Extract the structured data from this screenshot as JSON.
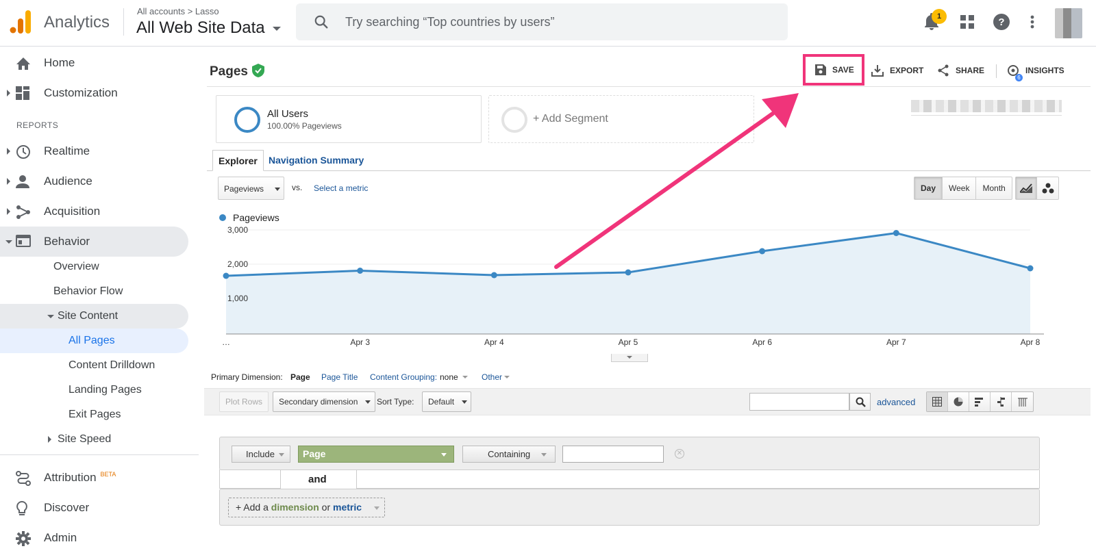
{
  "app": {
    "name": "Analytics"
  },
  "account": {
    "breadcrumb": "All accounts > Lasso",
    "view": "All Web Site Data"
  },
  "search": {
    "placeholder": "Try searching “Top countries by users”"
  },
  "notifications": {
    "count": "1"
  },
  "sidebar": {
    "items": [
      {
        "label": "Home",
        "icon": "home-icon"
      },
      {
        "label": "Customization",
        "icon": "dashboard-icon"
      }
    ],
    "reports_label": "REPORTS",
    "reports": [
      {
        "label": "Realtime",
        "icon": "clock-icon"
      },
      {
        "label": "Audience",
        "icon": "person-icon"
      },
      {
        "label": "Acquisition",
        "icon": "fork-icon"
      },
      {
        "label": "Behavior",
        "icon": "browser-window-icon"
      }
    ],
    "behavior_children": {
      "overview": "Overview",
      "behavior_flow": "Behavior Flow",
      "site_content": "Site Content",
      "all_pages": "All Pages",
      "content_drilldown": "Content Drilldown",
      "landing_pages": "Landing Pages",
      "exit_pages": "Exit Pages",
      "site_speed": "Site Speed"
    },
    "bottom": [
      {
        "label": "Attribution",
        "badge": "BETA",
        "icon": "attribution-icon"
      },
      {
        "label": "Discover",
        "icon": "lightbulb-icon"
      },
      {
        "label": "Admin",
        "icon": "gear-icon"
      }
    ]
  },
  "report": {
    "title": "Pages",
    "toolbar": {
      "save": "SAVE",
      "export": "EXPORT",
      "share": "SHARE",
      "insights": "INSIGHTS",
      "insights_count": "6"
    }
  },
  "segments": {
    "all_users": {
      "name": "All Users",
      "sub": "100.00% Pageviews"
    },
    "add": "+ Add Segment"
  },
  "tabs": {
    "explorer": "Explorer",
    "nav_summary": "Navigation Summary"
  },
  "controls": {
    "metric": "Pageviews",
    "vs": "vs.",
    "select_metric": "Select a metric",
    "day": "Day",
    "week": "Week",
    "month": "Month"
  },
  "chart_data": {
    "type": "area",
    "series": [
      {
        "name": "Pageviews",
        "values": [
          1700,
          1850,
          1720,
          1800,
          2420,
          2950,
          1920
        ]
      }
    ],
    "categories": [
      "…",
      "Apr 3",
      "Apr 4",
      "Apr 5",
      "Apr 6",
      "Apr 7",
      "Apr 8"
    ],
    "yticks": [
      "3,000",
      "2,000",
      "1,000"
    ],
    "ylim": [
      0,
      3000
    ],
    "grid": true,
    "colors": {
      "line": "#3b88c4",
      "fill": "#e7f1f8"
    }
  },
  "dimension": {
    "label": "Primary Dimension:",
    "page": "Page",
    "page_title": "Page Title",
    "content_grouping": "Content Grouping:",
    "grouping_value": "none",
    "other": "Other"
  },
  "table_controls": {
    "plot_rows": "Plot Rows",
    "secondary": "Secondary dimension",
    "sort_type_label": "Sort Type:",
    "sort_type": "Default",
    "advanced": "advanced"
  },
  "filter": {
    "include": "Include",
    "dimension": "Page",
    "match": "Containing",
    "and": "and",
    "add_prefix": "+ Add a ",
    "add_dimension": "dimension",
    "add_or": " or ",
    "add_metric": "metric"
  }
}
